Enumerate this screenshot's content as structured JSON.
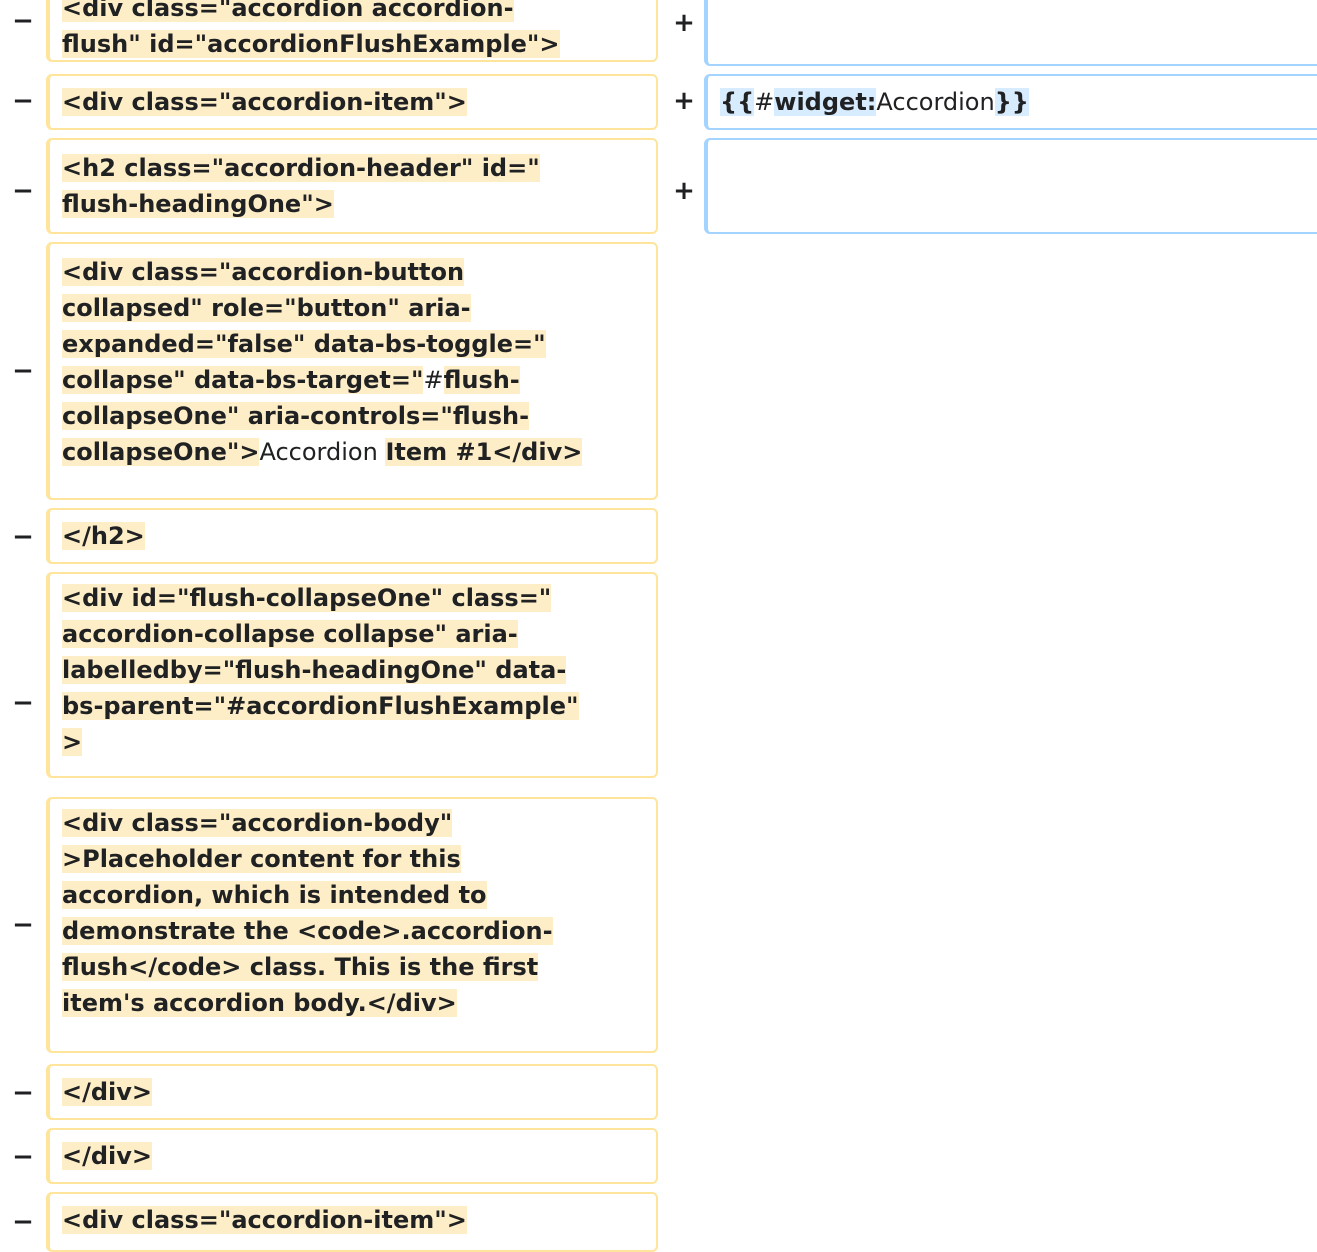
{
  "diff": {
    "minus_marker": "−",
    "plus_marker": "+",
    "deleted": [
      {
        "parts": [
          {
            "t": "<div class=\"accordion accordion-\nflush\" id=\"accordionFlushExample\">",
            "b": true
          }
        ]
      },
      {
        "parts": [
          {
            "t": "<div class=\"accordion-item\">",
            "b": true
          }
        ]
      },
      {
        "parts": [
          {
            "t": "<h2 class=\"accordion-header\" id=\"\nflush-headingOne\">",
            "b": true
          }
        ]
      },
      {
        "parts": [
          {
            "t": "<div class=\"accordion-button\ncollapsed\" role=\"button\" aria-\nexpanded=\"false\" data-bs-toggle=\"\ncollapse\" data-bs-target=\"",
            "b": true
          },
          {
            "t": "#",
            "b": false
          },
          {
            "t": "flush-\ncollapseOne\" aria-controls=\"flush-\ncollapseOne\">",
            "b": true
          },
          {
            "t": "Accordion ",
            "b": false
          },
          {
            "t": "Item #1</div>",
            "b": true
          }
        ]
      },
      {
        "parts": [
          {
            "t": "</h2>",
            "b": true
          }
        ]
      },
      {
        "parts": [
          {
            "t": "<div id=\"flush-collapseOne\" class=\"\naccordion-collapse collapse\" aria-\nlabelledby=\"flush-headingOne\" data-\nbs-parent=\"#accordionFlushExample\"\n>",
            "b": true
          }
        ]
      },
      {
        "parts": [
          {
            "t": "<div class=\"accordion-body\"\n>Placeholder content for this\naccordion, which is intended to\ndemonstrate the <code>.accordion-\nflush</code> class. This is the first\nitem's accordion body.</div>",
            "b": true
          }
        ]
      },
      {
        "parts": [
          {
            "t": "</div>",
            "b": true
          }
        ]
      },
      {
        "parts": [
          {
            "t": "</div>",
            "b": true
          }
        ]
      },
      {
        "parts": [
          {
            "t": "<div class=\"accordion-item\">",
            "b": true
          }
        ]
      }
    ],
    "inserted": [
      {
        "parts": []
      },
      {
        "parts": [
          {
            "t": "{{",
            "b": true
          },
          {
            "t": "#",
            "b": false
          },
          {
            "t": "widget:",
            "b": true
          },
          {
            "t": "Accordion",
            "b": false
          },
          {
            "t": "}}",
            "b": true
          }
        ]
      },
      {
        "parts": []
      }
    ]
  }
}
